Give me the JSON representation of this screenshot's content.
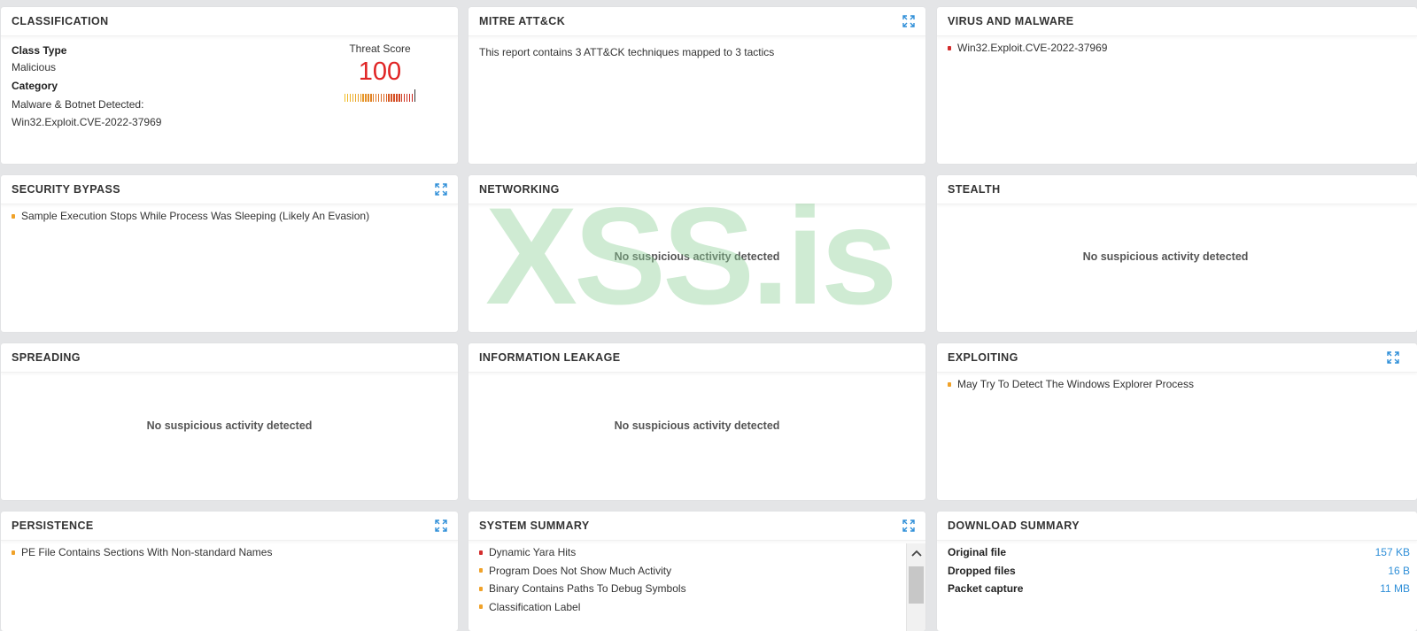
{
  "classification": {
    "title": "CLASSIFICATION",
    "class_type_label": "Class Type",
    "class_type_value": "Malicious",
    "category_label": "Category",
    "category_value_1": "Malware & Botnet Detected:",
    "category_value_2": "Win32.Exploit.CVE-2022-37969",
    "threat_score_label": "Threat Score",
    "threat_score": "100"
  },
  "mitre": {
    "title": "MITRE ATT&CK",
    "text": "This report contains 3 ATT&CK techniques mapped to 3 tactics"
  },
  "virus": {
    "title": "VIRUS AND MALWARE",
    "items": [
      "Win32.Exploit.CVE-2022-37969"
    ]
  },
  "security_bypass": {
    "title": "SECURITY BYPASS",
    "items": [
      "Sample Execution Stops While Process Was Sleeping (Likely An Evasion)"
    ]
  },
  "networking": {
    "title": "NETWORKING",
    "empty": "No suspicious activity detected"
  },
  "stealth": {
    "title": "STEALTH",
    "empty": "No suspicious activity detected"
  },
  "spreading": {
    "title": "SPREADING",
    "empty": "No suspicious activity detected"
  },
  "info_leakage": {
    "title": "INFORMATION LEAKAGE",
    "empty": "No suspicious activity detected"
  },
  "exploiting": {
    "title": "EXPLOITING",
    "items": [
      "May Try To Detect The Windows Explorer Process"
    ]
  },
  "persistence": {
    "title": "PERSISTENCE",
    "items": [
      "PE File Contains Sections With Non-standard Names"
    ]
  },
  "system_summary": {
    "title": "SYSTEM SUMMARY",
    "items": [
      "Dynamic Yara Hits",
      "Program Does Not Show Much Activity",
      "Binary Contains Paths To Debug Symbols",
      "Classification Label"
    ]
  },
  "download_summary": {
    "title": "DOWNLOAD SUMMARY",
    "rows": [
      {
        "label": "Original file",
        "value": "157 KB"
      },
      {
        "label": "Dropped files",
        "value": "16 B"
      },
      {
        "label": "Packet capture",
        "value": "11 MB"
      }
    ]
  },
  "watermark": "XSS.is",
  "colors": {
    "accent": "#2f8fd8",
    "danger": "#d32d2d",
    "warning": "#f0a229",
    "threat_score": "#e02424",
    "watermark": "#8dcf96"
  },
  "icons": {
    "expand": "expand-icon",
    "scroll_up": "chevron-up-icon"
  }
}
